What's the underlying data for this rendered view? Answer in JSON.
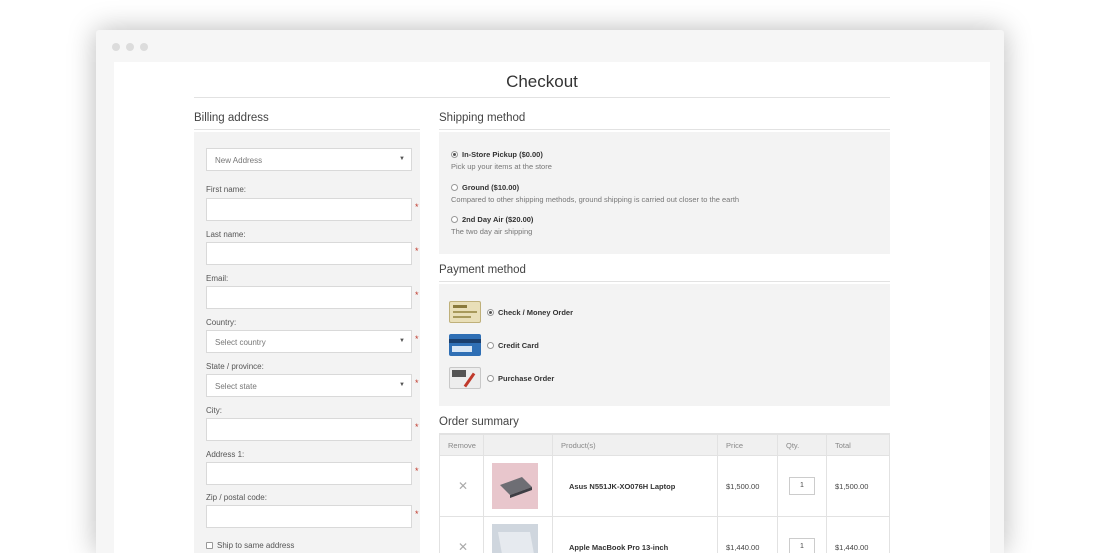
{
  "page": {
    "title": "Checkout"
  },
  "billing": {
    "title": "Billing address",
    "address_select": "New Address",
    "first_name_label": "First name:",
    "last_name_label": "Last name:",
    "email_label": "Email:",
    "country_label": "Country:",
    "country_select": "Select country",
    "state_label": "State / province:",
    "state_select": "Select state",
    "city_label": "City:",
    "address1_label": "Address 1:",
    "zip_label": "Zip / postal code:",
    "ship_same_label": "Ship to same address"
  },
  "shipping": {
    "title": "Shipping method",
    "options": [
      {
        "name": "In-Store Pickup ($0.00)",
        "desc": "Pick up your items at the store",
        "selected": true
      },
      {
        "name": "Ground ($10.00)",
        "desc": "Compared to other shipping methods, ground shipping is carried out closer to the earth",
        "selected": false
      },
      {
        "name": "2nd Day Air ($20.00)",
        "desc": "The two day air shipping",
        "selected": false
      }
    ]
  },
  "payment": {
    "title": "Payment method",
    "options": [
      {
        "name": "Check / Money Order",
        "selected": true
      },
      {
        "name": "Credit Card",
        "selected": false
      },
      {
        "name": "Purchase Order",
        "selected": false
      }
    ]
  },
  "order": {
    "title": "Order summary",
    "headers": [
      "Remove",
      "",
      "Product(s)",
      "Price",
      "Qty.",
      "Total"
    ],
    "rows": [
      {
        "product": "Asus N551JK-XO076H Laptop",
        "price": "$1,500.00",
        "qty": "1",
        "total": "$1,500.00"
      },
      {
        "product": "Apple MacBook Pro 13-inch",
        "price": "$1,440.00",
        "qty": "1",
        "total": "$1,440.00"
      }
    ]
  },
  "colors": {
    "required": "#c0392b",
    "panel": "#f3f3f3",
    "border": "#e2e2e2"
  }
}
